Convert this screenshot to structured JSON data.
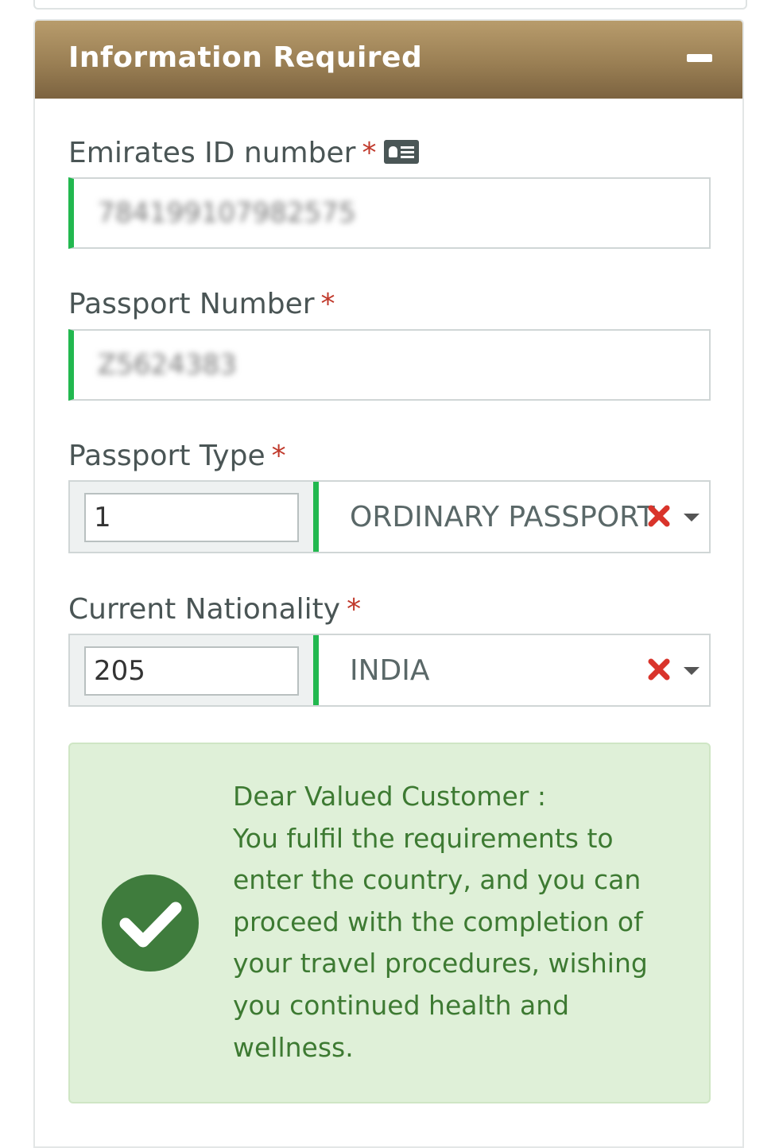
{
  "panel": {
    "title": "Information Required"
  },
  "fields": {
    "emirates_id": {
      "label": "Emirates ID number",
      "required_mark": "*",
      "value": "784199107982575"
    },
    "passport_number": {
      "label": "Passport Number",
      "required_mark": "*",
      "value": "Z5624383"
    },
    "passport_type": {
      "label": "Passport Type",
      "required_mark": "*",
      "code": "1",
      "selected": "ORDINARY PASSPORT"
    },
    "nationality": {
      "label": "Current Nationality",
      "required_mark": "*",
      "code": "205",
      "selected": "INDIA"
    }
  },
  "alert": {
    "greeting": "Dear Valued Customer :",
    "message": "You fulfil the requirements to enter the country, and you can proceed with the completion of your travel procedures, wishing you continued health and wellness."
  },
  "colors": {
    "header_gradient_top": "#b89c6c",
    "header_gradient_bottom": "#7c6340",
    "valid_accent": "#22b84f",
    "required_star": "#c0392b",
    "alert_bg": "#dff0d8",
    "alert_text": "#3d7a32",
    "check_circle": "#3f7c3d"
  },
  "icons": {
    "collapse": "minus-icon",
    "id_card": "id-card-icon",
    "clear": "clear-x-icon",
    "dropdown": "caret-down-icon",
    "success": "check-circle-icon"
  }
}
